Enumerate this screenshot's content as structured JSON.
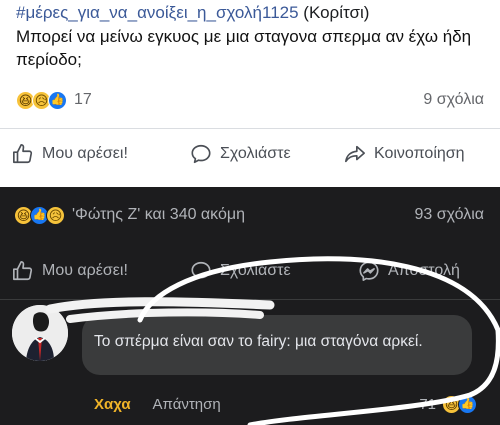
{
  "post": {
    "hashtag": "#μέρες_για_να_ανοίξει_η_σχολή1125",
    "gender": "(Κορίτσι)",
    "text": "Μπορεί να μείνω εγκυος με μια σταγονα σπερμα αν έχω ήδη περίοδο;",
    "reaction_icons": [
      "haha-icon",
      "sad-icon",
      "like-icon"
    ],
    "reaction_count": "17",
    "comment_count": "9 σχόλια",
    "actions": {
      "like": "Μου αρέσει!",
      "comment": "Σχολιάστε",
      "share": "Κοινοποίηση"
    }
  },
  "shared": {
    "reaction_icons": [
      "haha-icon",
      "like-icon",
      "sad-icon"
    ],
    "likers": "'Φώτης Ζ' και 340 ακόμη",
    "comment_count": "93 σχόλια",
    "actions": {
      "like": "Μου αρέσει!",
      "comment": "Σχολιάστε",
      "send": "Αποστολή"
    }
  },
  "comment": {
    "text": "Το σπέρμα είναι σαν το fairy: μια σταγόνα αρκεί.",
    "haha": "Χαχα",
    "reply": "Απάντηση",
    "reaction_count": "71"
  },
  "colors": {
    "hashtag": "#3b5998",
    "like_blue": "#1877f2",
    "haha_yellow": "#f0b429",
    "dark_bg": "#1c1c1e",
    "bubble_bg": "#3a3b3c"
  }
}
